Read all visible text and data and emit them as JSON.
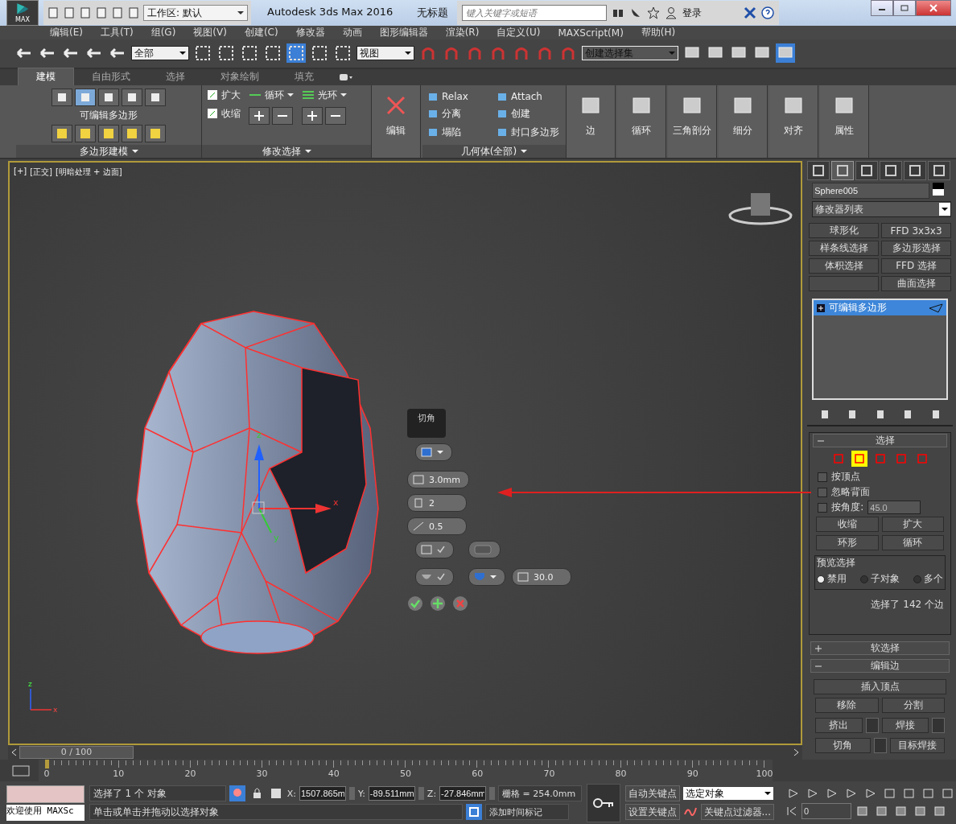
{
  "title_bar": {
    "logo": "MAX",
    "workspace": "工作区: 默认",
    "title": "Autodesk 3ds Max 2016",
    "document": "无标题",
    "search": {
      "placeholder": "键入关键字或短语"
    },
    "sign_in": "登录"
  },
  "menu": [
    "编辑(E)",
    "工具(T)",
    "组(G)",
    "视图(V)",
    "创建(C)",
    "修改器",
    "动画",
    "图形编辑器",
    "渲染(R)",
    "自定义(U)",
    "MAXScript(M)",
    "帮助(H)"
  ],
  "toolbar": {
    "filter": "全部",
    "reference_coord": "视图",
    "selection_set": "创建选择集"
  },
  "ribbon": {
    "tabs": [
      {
        "label": "建模",
        "selected": true
      },
      {
        "label": "自由形式",
        "selected": false
      },
      {
        "label": "选择",
        "selected": false
      },
      {
        "label": "对象绘制",
        "selected": false
      },
      {
        "label": "填充",
        "selected": false
      }
    ],
    "poly_modeling": {
      "title": "可编辑多边形",
      "label": "多边形建模"
    },
    "modify_selection": {
      "grow": "扩大",
      "shrink": "收缩",
      "loop": "循环",
      "ring": "光环",
      "label": "修改选择"
    },
    "edit": "编辑",
    "geometry": {
      "items": [
        "Relax",
        "Attach",
        "分离",
        "创建",
        "塌陷",
        "封口多边形"
      ],
      "label": "几何体(全部)"
    },
    "big_buttons": [
      "边",
      "循环",
      "三角剖分",
      "细分",
      "对齐",
      "属性"
    ]
  },
  "viewport": {
    "labels": [
      "[+]",
      "[正交]",
      "[明暗处理 + 边面]"
    ],
    "gizmo": {
      "x": "x",
      "y": "y",
      "z": "z"
    },
    "corner_axes": {
      "x": "x",
      "z": "z"
    },
    "caddy": {
      "title": "切角",
      "amount": "3.0mm",
      "segments": "2",
      "tension": "0.5",
      "open_chamfer": {
        "checked": true
      },
      "invert": {
        "on": false
      },
      "smooth": {
        "checked": true
      },
      "smooth_threshold": "30.0"
    }
  },
  "command_panel": {
    "tabs": [
      {
        "selected": false
      },
      {
        "selected": true
      },
      {
        "selected": false
      },
      {
        "selected": false
      },
      {
        "selected": false
      },
      {
        "selected": false
      }
    ],
    "object_name": "Sphere005",
    "modifier_list": "修改器列表",
    "modifier_buttons": [
      [
        "球形化",
        "FFD 3x3x3"
      ],
      [
        "样条线选择",
        "多边形选择"
      ],
      [
        "体积选择",
        "FFD 选择"
      ],
      [
        "曲面选择"
      ]
    ],
    "stack": [
      {
        "label": "可编辑多边形",
        "selected": true
      }
    ],
    "selection": {
      "title": "选择",
      "expanded": true,
      "levels": [
        {
          "selected": false
        },
        {
          "selected": true
        },
        {
          "selected": false
        },
        {
          "selected": false
        },
        {
          "selected": false
        }
      ],
      "checks": [
        {
          "label": "按顶点",
          "checked": false
        },
        {
          "label": "忽略背面",
          "checked": false
        }
      ],
      "by_angle": {
        "label": "按角度:",
        "checked": false,
        "value": "45.0"
      },
      "shrink": "收缩",
      "grow": "扩大",
      "ring": "环形",
      "loop": "循环",
      "preview": {
        "title": "预览选择",
        "options": [
          {
            "label": "禁用",
            "selected": true
          },
          {
            "label": "子对象",
            "selected": false
          },
          {
            "label": "多个",
            "selected": false
          }
        ]
      },
      "status": "选择了 142 个边"
    },
    "soft_selection": {
      "title": "软选择",
      "expanded": false
    },
    "edit_edges": {
      "title": "编辑边",
      "expanded": true,
      "insert_vertex": "插入顶点",
      "remove": "移除",
      "split": "分割",
      "extrude": "挤出",
      "weld": "焊接",
      "chamfer": "切角",
      "target_weld": "目标焊接"
    }
  },
  "time_slider": {
    "frame": "0 / 100"
  },
  "track_bar": {
    "ticks": [
      "0",
      "10",
      "20",
      "30",
      "40",
      "50",
      "60",
      "70",
      "80",
      "90",
      "100"
    ]
  },
  "status_bar": {
    "listener": "欢迎使用 MAXSc",
    "selected": "选择了 1 个 对象",
    "prompt": "单击或单击并拖动以选择对象",
    "x": {
      "label": "X:",
      "value": "1507.865m"
    },
    "y": {
      "label": "Y:",
      "value": "-89.511mm"
    },
    "z": {
      "label": "Z:",
      "value": "-27.846mm"
    },
    "grid": "栅格 = 254.0mm",
    "time_tag": "添加时间标记",
    "auto_key": "自动关键点",
    "set_key": "设置关键点",
    "key_mode": "选定对象",
    "key_filters": "关键点过滤器...",
    "frame": "0"
  }
}
